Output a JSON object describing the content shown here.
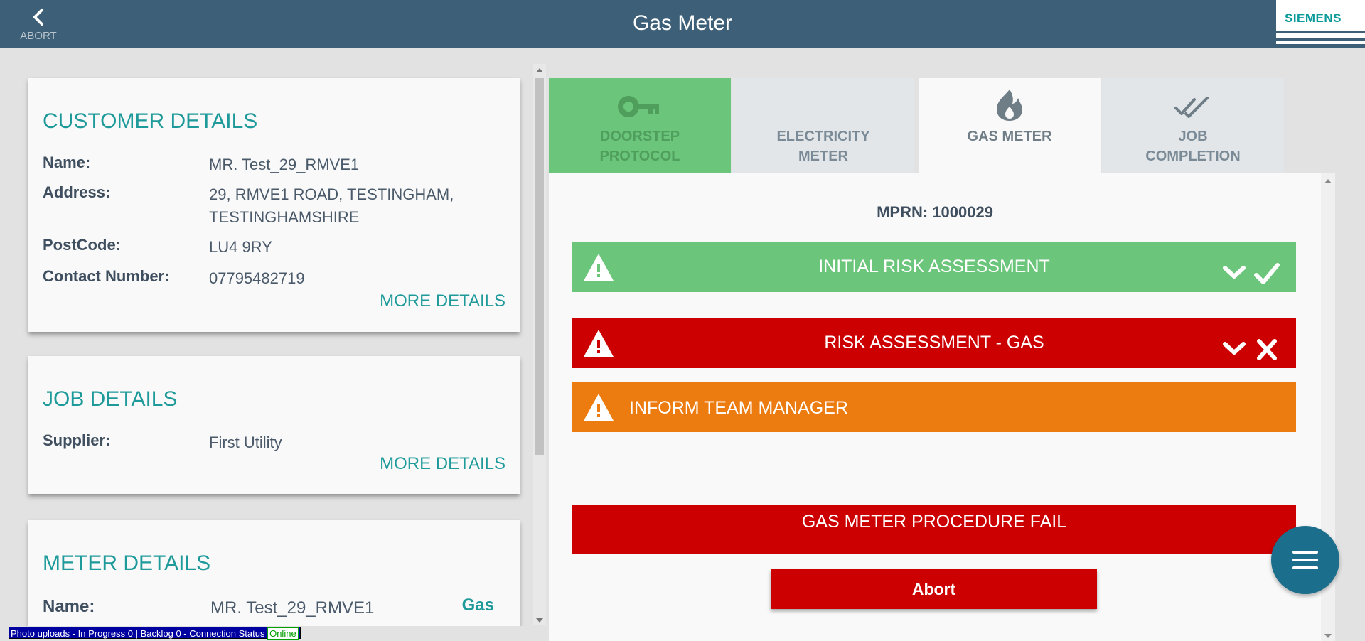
{
  "header": {
    "back_label": "ABORT",
    "title": "Gas Meter",
    "logo_text": "SIEMENS"
  },
  "customer": {
    "heading": "CUSTOMER DETAILS",
    "name_label": "Name:",
    "name_value": "MR. Test_29_RMVE1",
    "address_label": "Address:",
    "address_line1": "29, RMVE1 ROAD, TESTINGHAM,",
    "address_line2": "TESTINGHAMSHIRE",
    "postcode_label": "PostCode:",
    "postcode_value": "LU4 9RY",
    "contact_label": "Contact Number:",
    "contact_value": "07795482719",
    "more": "MORE DETAILS"
  },
  "job": {
    "heading": "JOB DETAILS",
    "supplier_label": "Supplier:",
    "supplier_value": "First Utility",
    "more": "MORE DETAILS"
  },
  "meter": {
    "heading": "METER DETAILS",
    "name_label": "Name:",
    "name_value": "MR. Test_29_RMVE1",
    "type_tag": "Gas"
  },
  "tabs": [
    {
      "line1": "DOORSTEP",
      "line2": "PROTOCOL",
      "icon": "key-icon"
    },
    {
      "line1": "ELECTRICITY",
      "line2": "METER",
      "icon": "none"
    },
    {
      "line1": "GAS METER",
      "line2": "",
      "icon": "flame-icon"
    },
    {
      "line1": "JOB",
      "line2": "COMPLETION",
      "icon": "double-check-icon"
    }
  ],
  "panel": {
    "mprn": "MPRN: 1000029",
    "sections": [
      {
        "label": "INITIAL RISK ASSESSMENT",
        "status": "pass",
        "color": "#6bc57a"
      },
      {
        "label": "RISK ASSESSMENT - GAS",
        "status": "fail",
        "color": "#cc0000"
      },
      {
        "label": "INFORM TEAM MANAGER",
        "status": "warning",
        "color": "#ec7b10"
      }
    ],
    "fail_message": "GAS METER PROCEDURE FAIL",
    "abort_button": "Abort"
  },
  "status_bar": {
    "text": "Photo uploads - In Progress 0 | Backlog 0 - Connection Status",
    "connection": "Online"
  },
  "colors": {
    "header": "#3d5f78",
    "teal": "#1e9a9a",
    "success": "#6bc57a",
    "danger": "#cc0000",
    "warning": "#ec7b10"
  }
}
